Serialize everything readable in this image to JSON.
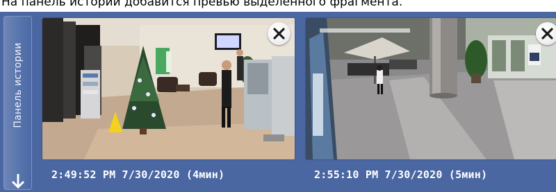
{
  "caption": "На панель истории добавится превью выделенного фрагмента.",
  "history_panel": {
    "tab_label": "Панель истории",
    "arrow_icon": "arrow-down-icon",
    "background_color": "#4a67a2",
    "thumbnails": [
      {
        "timestamp": "2:49:52 PM 7/30/2020 (4мин)",
        "close_icon": "close-icon"
      },
      {
        "timestamp": "2:55:10 PM 7/30/2020 (5мин)",
        "close_icon": "close-icon"
      }
    ]
  }
}
